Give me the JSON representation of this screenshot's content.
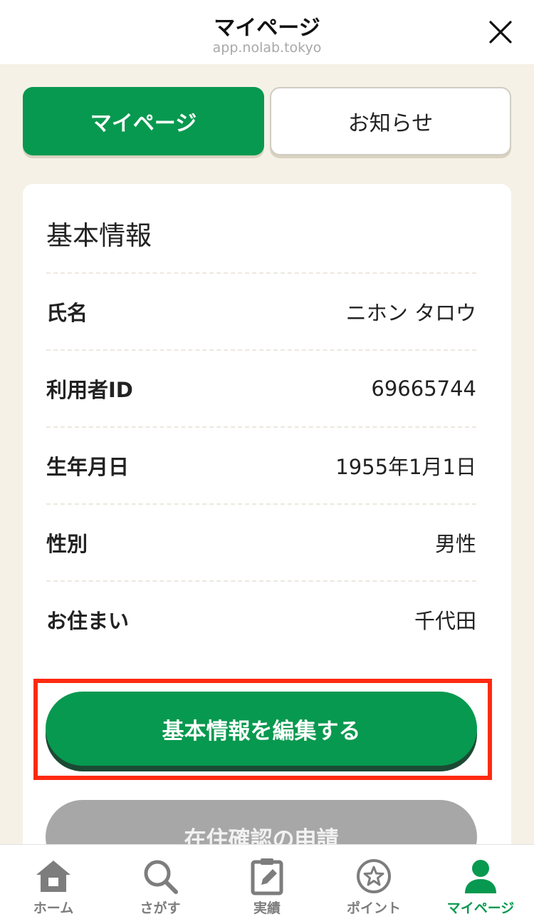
{
  "header": {
    "title": "マイページ",
    "url": "app.nolab.tokyo"
  },
  "tabs": [
    {
      "label": "マイページ",
      "active": true
    },
    {
      "label": "お知らせ",
      "active": false
    }
  ],
  "basic_info": {
    "title": "基本情報",
    "rows": [
      {
        "label": "氏名",
        "value": "ニホン タロウ"
      },
      {
        "label": "利用者ID",
        "value": "69665744"
      },
      {
        "label": "生年月日",
        "value": "1955年1月1日"
      },
      {
        "label": "性別",
        "value": "男性"
      },
      {
        "label": "お住まい",
        "value": "千代田"
      }
    ],
    "edit_button": "基本情報を編集する",
    "residence_button": "在住確認の申請"
  },
  "bottom_nav": [
    {
      "label": "ホーム",
      "icon": "home-icon"
    },
    {
      "label": "さがす",
      "icon": "search-icon"
    },
    {
      "label": "実績",
      "icon": "clipboard-edit-icon"
    },
    {
      "label": "ポイント",
      "icon": "star-circle-icon"
    },
    {
      "label": "マイページ",
      "icon": "user-icon",
      "active": true
    }
  ],
  "colors": {
    "brand_green": "#07994f",
    "background": "#f5f1e6",
    "highlight_red": "#ff2a10",
    "disabled_gray": "#a7a7a7"
  }
}
